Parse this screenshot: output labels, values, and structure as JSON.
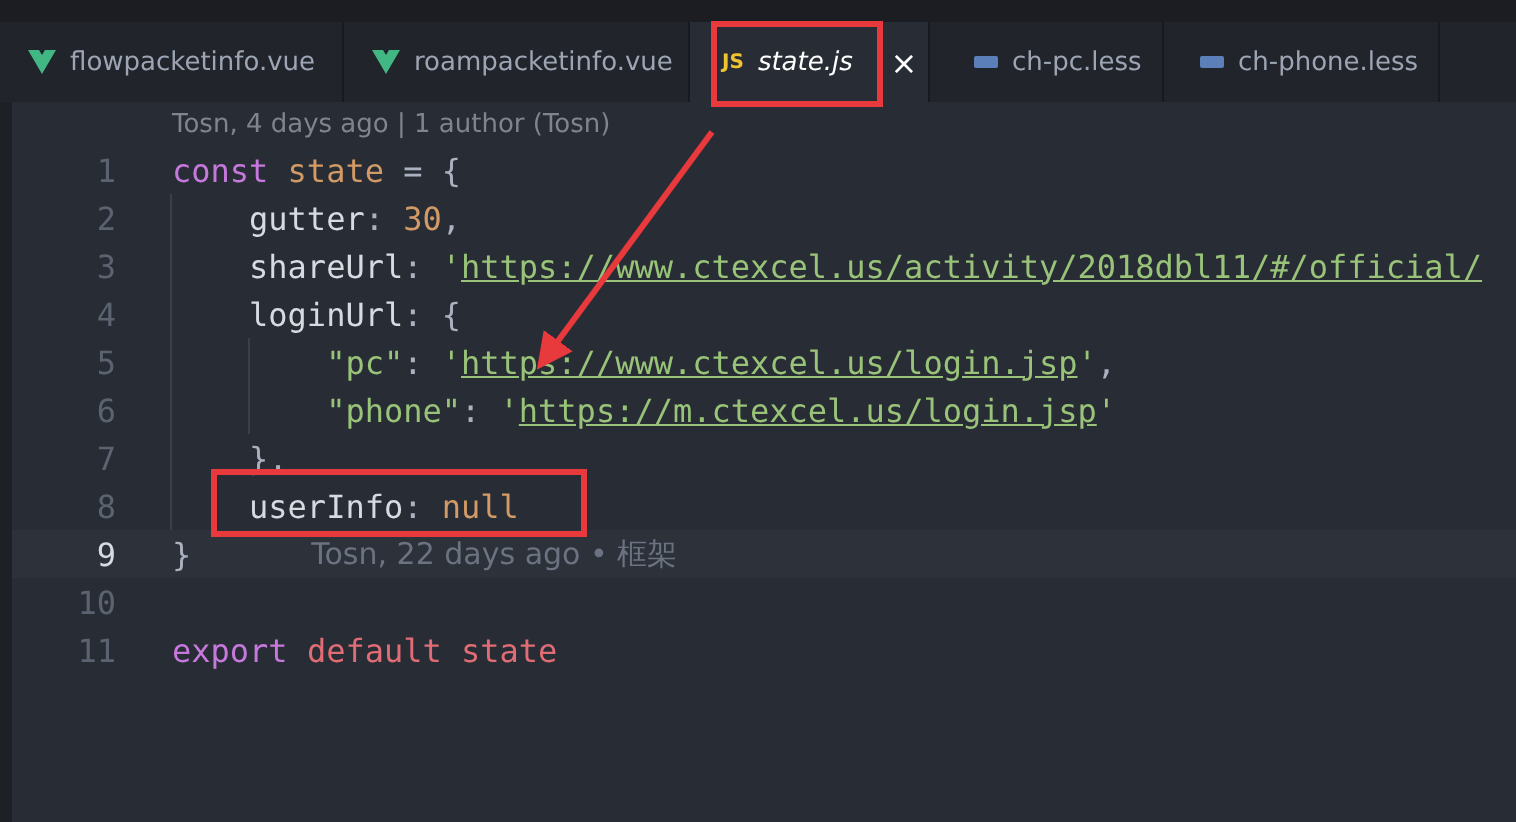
{
  "tabs": [
    {
      "label": "flowpacketinfo.vue",
      "kind": "vue",
      "selected": false
    },
    {
      "label": "roampacketinfo.vue",
      "kind": "vue",
      "selected": false
    },
    {
      "label": "state.js",
      "kind": "js",
      "badge": "JS",
      "selected": true,
      "close": "×"
    },
    {
      "label": "ch-pc.less",
      "kind": "less",
      "selected": false
    },
    {
      "label": "ch-phone.less",
      "kind": "less",
      "selected": false
    }
  ],
  "codelens": "Tosn, 4 days ago | 1 author (Tosn)",
  "lines": [
    {
      "number": "1",
      "current": false,
      "tokens": [
        {
          "t": "const ",
          "kind": "keyword"
        },
        {
          "t": "state",
          "kind": "variable"
        },
        {
          "t": " = {",
          "kind": "punct"
        }
      ]
    },
    {
      "number": "2",
      "current": false,
      "tokens": [
        {
          "t": "    gutter",
          "kind": "property"
        },
        {
          "t": ": ",
          "kind": "punct"
        },
        {
          "t": "30",
          "kind": "number"
        },
        {
          "t": ",",
          "kind": "punct"
        }
      ]
    },
    {
      "number": "3",
      "current": false,
      "tokens": [
        {
          "t": "    shareUrl",
          "kind": "property"
        },
        {
          "t": ": ",
          "kind": "punct"
        },
        {
          "t": "'",
          "kind": "string"
        },
        {
          "t": "https://www.ctexcel.us/activity/2018dbl11/#/official/",
          "kind": "link"
        }
      ]
    },
    {
      "number": "4",
      "current": false,
      "tokens": [
        {
          "t": "    loginUrl",
          "kind": "property"
        },
        {
          "t": ": {",
          "kind": "punct"
        }
      ]
    },
    {
      "number": "5",
      "current": false,
      "tokens": [
        {
          "t": "        \"pc\"",
          "kind": "string"
        },
        {
          "t": ": ",
          "kind": "punct"
        },
        {
          "t": "'",
          "kind": "string"
        },
        {
          "t": "https://www.ctexcel.us/login.jsp",
          "kind": "link"
        },
        {
          "t": "'",
          "kind": "string"
        },
        {
          "t": ",",
          "kind": "punct"
        }
      ]
    },
    {
      "number": "6",
      "current": false,
      "tokens": [
        {
          "t": "        \"phone\"",
          "kind": "string"
        },
        {
          "t": ": ",
          "kind": "punct"
        },
        {
          "t": "'",
          "kind": "string"
        },
        {
          "t": "https://m.ctexcel.us/login.jsp",
          "kind": "link"
        },
        {
          "t": "'",
          "kind": "string"
        }
      ]
    },
    {
      "number": "7",
      "current": false,
      "tokens": [
        {
          "t": "    },",
          "kind": "punct"
        }
      ]
    },
    {
      "number": "8",
      "current": false,
      "tokens": [
        {
          "t": "    userInfo",
          "kind": "property"
        },
        {
          "t": ": ",
          "kind": "punct"
        },
        {
          "t": "null",
          "kind": "number"
        }
      ]
    },
    {
      "number": "9",
      "current": true,
      "tokens": [
        {
          "t": "}",
          "kind": "punct"
        }
      ],
      "blame": "Tosn, 22 days ago • 框架"
    },
    {
      "number": "10",
      "current": false
    },
    {
      "number": "11",
      "current": false,
      "tokens": [
        {
          "t": "export ",
          "kind": "keyword"
        },
        {
          "t": "default state",
          "kind": "keyword2"
        }
      ]
    }
  ]
}
